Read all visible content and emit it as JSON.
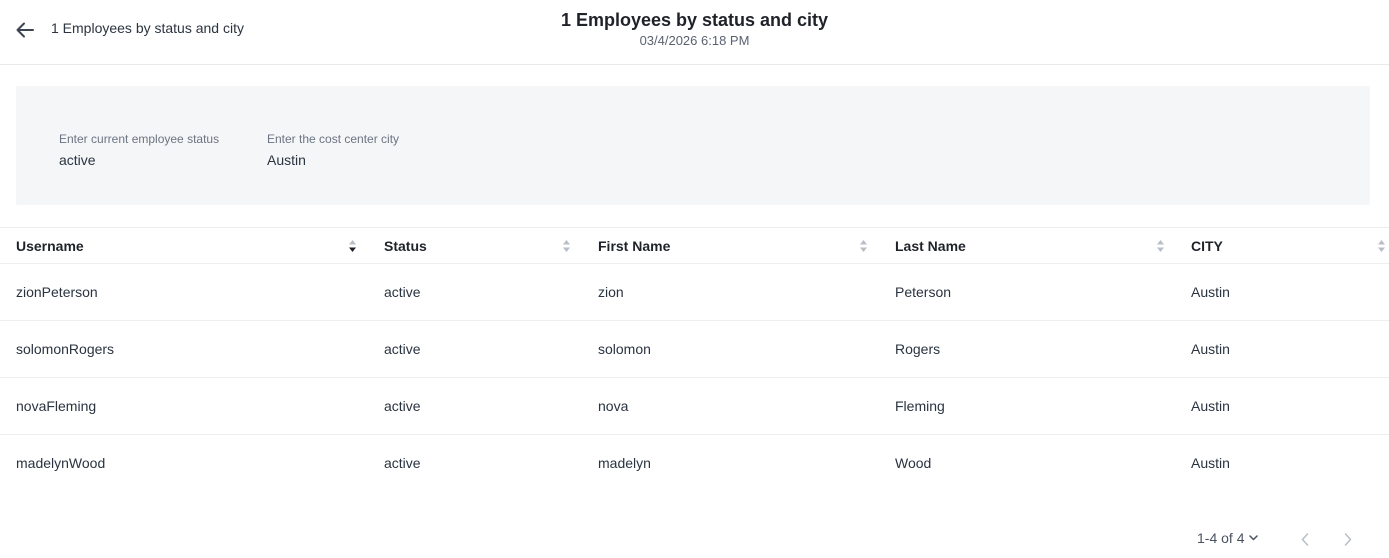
{
  "header": {
    "back_label": "1 Employees by status and city",
    "title": "1 Employees by status and city",
    "subtitle": "03/4/2026 6:18 PM"
  },
  "filters": [
    {
      "label": "Enter current employee status",
      "value": "active"
    },
    {
      "label": "Enter the cost center city",
      "value": "Austin"
    }
  ],
  "table": {
    "columns": [
      "Username",
      "Status",
      "First Name",
      "Last Name",
      "CITY"
    ],
    "rows": [
      [
        "zionPeterson",
        "active",
        "zion",
        "Peterson",
        "Austin"
      ],
      [
        "solomonRogers",
        "active",
        "solomon",
        "Rogers",
        "Austin"
      ],
      [
        "novaFleming",
        "active",
        "nova",
        "Fleming",
        "Austin"
      ],
      [
        "madelynWood",
        "active",
        "madelyn",
        "Wood",
        "Austin"
      ]
    ]
  },
  "pager": {
    "range_text": "1-4 of 4"
  },
  "icons": {
    "back": "arrow-left-icon",
    "sort": "sort-icon",
    "prev": "chevron-left-icon",
    "next": "chevron-right-icon",
    "dropdown": "chevron-down-icon"
  }
}
